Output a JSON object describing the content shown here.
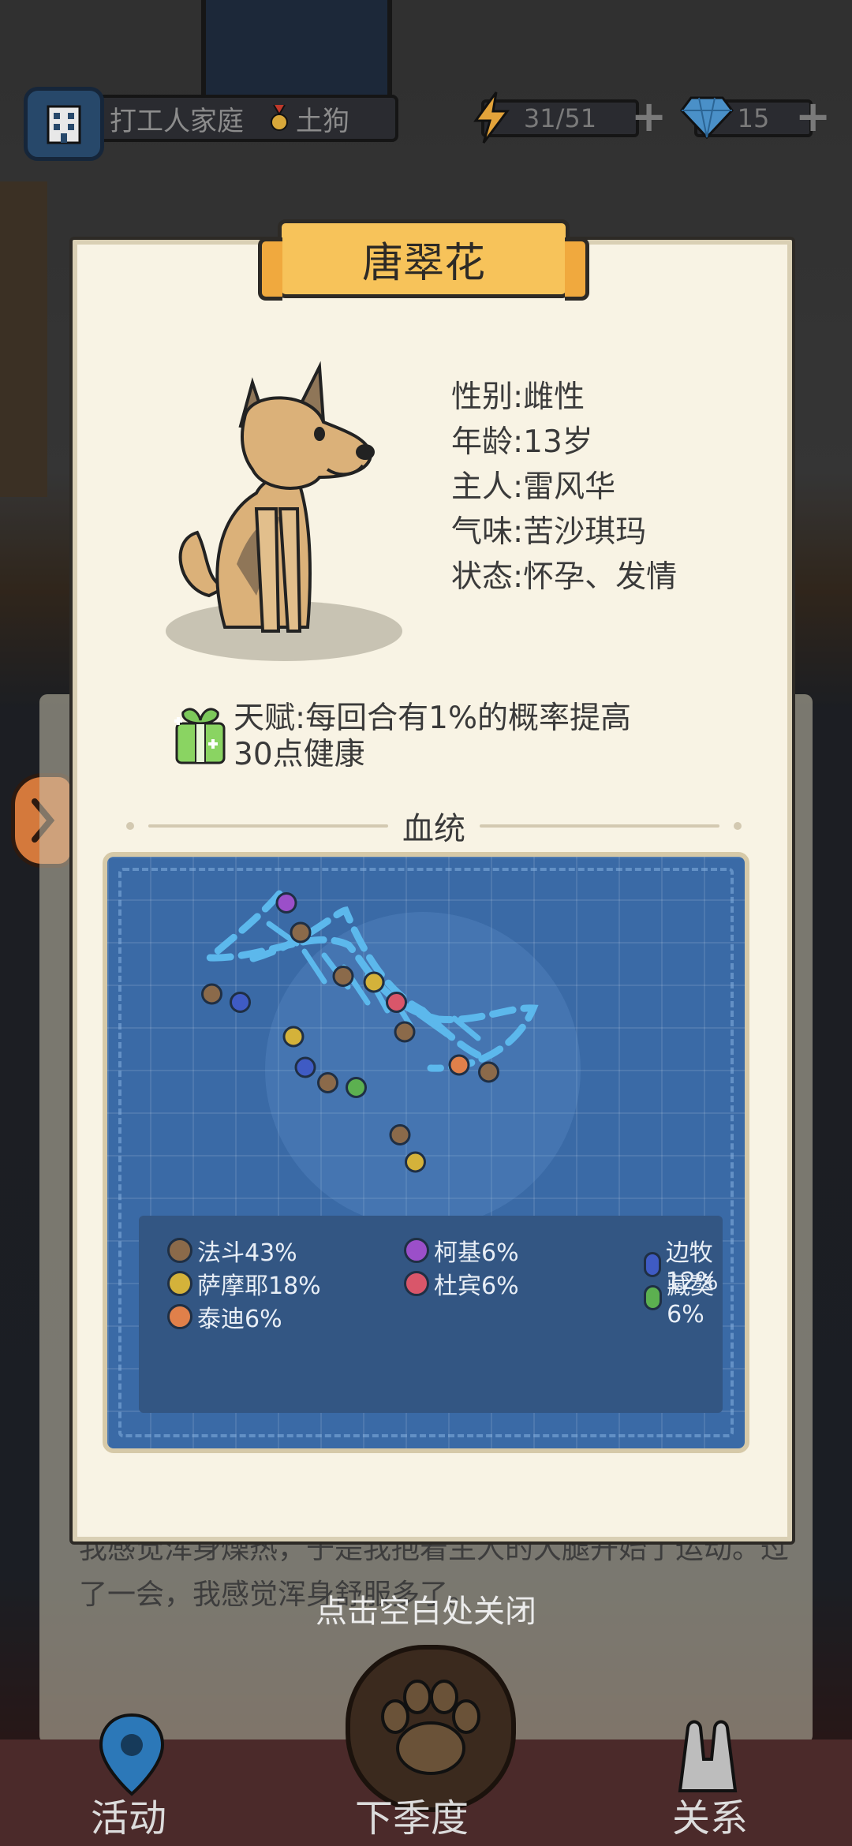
{
  "topbar": {
    "family_name": "打工人家庭",
    "rank": "土狗",
    "energy": "31/51",
    "gems": "15",
    "plus_symbol": "+"
  },
  "dog": {
    "name": "唐翠花",
    "gender": "性别:雌性",
    "age": "年龄:13岁",
    "owner": "主人:雷风华",
    "scent": "气味:苦沙琪玛",
    "status": "状态:怀孕、发情",
    "talent_line1": "天赋:每回合有1%的概率提高",
    "talent_line2": "30点健康"
  },
  "bloodline": {
    "title": "血统",
    "legend": [
      {
        "label": "法斗43%",
        "color": "#8b6a4a"
      },
      {
        "label": "柯基6%",
        "color": "#9b4fc9"
      },
      {
        "label": "边牧12%",
        "color": "#3f5bc4"
      },
      {
        "label": "萨摩耶18%",
        "color": "#d4b23a"
      },
      {
        "label": "杜宾6%",
        "color": "#d9566a"
      },
      {
        "label": "藏獒6%",
        "color": "#5cb050"
      },
      {
        "label": "泰迪6%",
        "color": "#e0804a"
      }
    ]
  },
  "story_text": "我感觉浑身燥热，于是我抱着主人的大腿开始了运动。过了一会，我感觉浑身舒服多了。",
  "close_hint": "点击空白处关闭",
  "nav": {
    "activity": "活动",
    "next_season": "下季度",
    "relations": "关系"
  }
}
